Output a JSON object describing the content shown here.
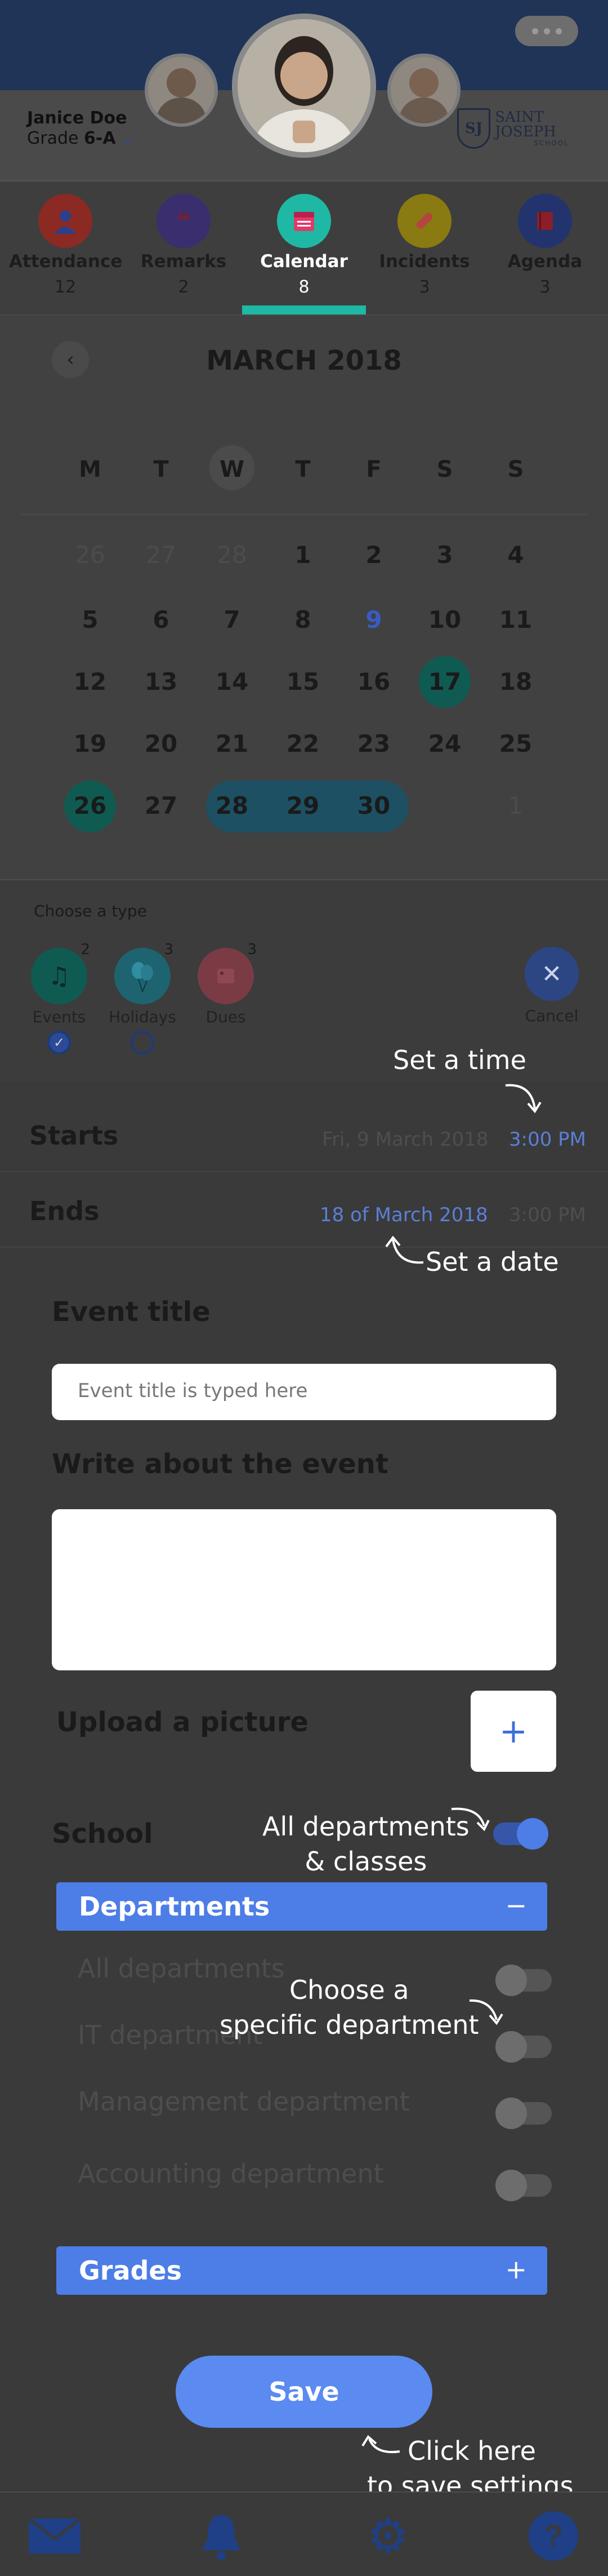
{
  "header": {
    "student_name": "Janice Doe",
    "grade_prefix": "Grade ",
    "grade_value": "6-A",
    "school_mark": "SJ",
    "school_name": "SAINT JOSEPH",
    "school_sub": "SCHOOL"
  },
  "tabs": [
    {
      "label": "Attendance",
      "count": "12",
      "icon": "user-icon",
      "color": "#8a2a23"
    },
    {
      "label": "Remarks",
      "count": "2",
      "icon": "quote-icon",
      "color": "#3a2e6e"
    },
    {
      "label": "Calendar",
      "count": "8",
      "icon": "calendar-icon",
      "color": "#1fb8a4"
    },
    {
      "label": "Incidents",
      "count": "3",
      "icon": "bandage-icon",
      "color": "#8a7a12"
    },
    {
      "label": "Agenda",
      "count": "3",
      "icon": "book-icon",
      "color": "#23336e"
    }
  ],
  "calendar": {
    "month": "MARCH 2018",
    "weekdays": [
      "M",
      "T",
      "W",
      "T",
      "F",
      "S",
      "S"
    ],
    "weeks": [
      [
        "26",
        "27",
        "28",
        "1",
        "2",
        "3",
        "4"
      ],
      [
        "5",
        "6",
        "7",
        "8",
        "9",
        "10",
        "11"
      ],
      [
        "12",
        "13",
        "14",
        "15",
        "16",
        "17",
        "18"
      ],
      [
        "19",
        "20",
        "21",
        "22",
        "23",
        "24",
        "25"
      ],
      [
        "26",
        "27",
        "28",
        "29",
        "30",
        "",
        "1"
      ]
    ]
  },
  "chooser": {
    "title": "Choose a type",
    "types": [
      {
        "label": "Events",
        "count": "2",
        "icon": "music-icon",
        "color": "#0f5b52",
        "selected": true
      },
      {
        "label": "Holidays",
        "count": "3",
        "icon": "balloon-icon",
        "color": "#1d6470",
        "selected": false
      },
      {
        "label": "Dues",
        "count": "3",
        "icon": "tag-icon",
        "color": "#7a3b45",
        "selected": false
      }
    ],
    "cancel_label": "Cancel"
  },
  "starts": {
    "label": "Starts",
    "date": "Fri, 9 March 2018",
    "time": "3:00 PM"
  },
  "ends": {
    "label": "Ends",
    "date": "18 of March 2018",
    "time": "3:00 PM"
  },
  "hints": {
    "set_time": "Set a time",
    "set_date": "Set a date",
    "all_departments_1": "All departments",
    "all_departments_2": "& classes",
    "choose_dept_1": "Choose a",
    "choose_dept_2": "specific department",
    "save_1": "Click here",
    "save_2": "to save settings"
  },
  "form": {
    "event_title_label": "Event title",
    "event_title_placeholder": "Event title is typed here",
    "description_label": "Write about the event",
    "upload_label": "Upload a picture",
    "school_label": "School",
    "departments_title": "Departments",
    "departments_toggle": "−",
    "departments": [
      "All departments",
      "IT department",
      "Management department",
      "Accounting department"
    ],
    "grades_title": "Grades",
    "grades_toggle": "+",
    "save_label": "Save"
  },
  "colors": {
    "accent": "#4d7de6",
    "teal": "#1fb8a4",
    "link_blue": "#5b7fd8"
  }
}
